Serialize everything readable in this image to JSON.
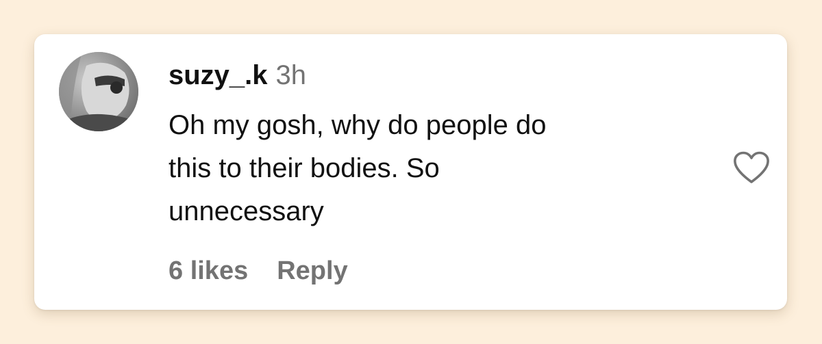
{
  "comment": {
    "username": "suzy_.k",
    "time": "3h",
    "text_lines": [
      "Oh my gosh, why do people do",
      "this to their bodies. So",
      "unnecessary"
    ],
    "likes": "6 likes",
    "reply_label": "Reply",
    "like_icon": "heart-outline-icon"
  },
  "colors": {
    "page_background": "#fdefdc",
    "card_background": "#ffffff",
    "text_primary": "#111111",
    "text_secondary": "#737373"
  }
}
